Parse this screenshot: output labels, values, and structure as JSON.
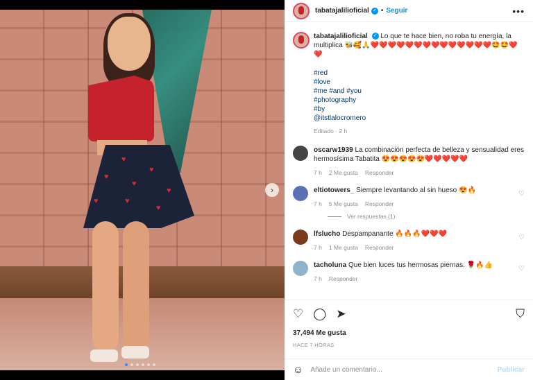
{
  "post": {
    "username": "tabatajalilioficial",
    "separator": "•",
    "follow_label": "Seguir",
    "more_label": "•••",
    "caption": {
      "username": "tabatajalilioficial",
      "text": "Lo que te hace bien, no roba tu energía, la multiplica 🐝🥰🙏❤️❤️❤️❤️❤️❤️❤️❤️❤️❤️❤️❤️❤️❤️🤩🤩❤️❤️",
      "hashtags": [
        "#red",
        "#love",
        "#me #and #you",
        "#photography",
        "#by",
        "@itstlalocromero"
      ],
      "edited": "Editado · 2 h"
    },
    "comments": [
      {
        "username": "oscarw1939",
        "text": "La combinación perfecta de belleza y sensualidad eres hermosísima Tabatita 😍😍😍😍😍❤️❤️❤️❤️❤️",
        "time": "7 h",
        "likes": "2 Me gusta",
        "reply": "Responder",
        "avatar_color": "#444444"
      },
      {
        "username": "eltiotowers_",
        "text": "Siempre levantando al sin hueso 😍🔥",
        "time": "7 h",
        "likes": "5 Me gusta",
        "reply": "Responder",
        "avatar_color": "#5b6fb5",
        "view_replies": "Ver respuestas (1)"
      },
      {
        "username": "lfslucho",
        "text": "Despampanante 🔥🔥🔥❤️❤️❤️",
        "time": "7 h",
        "likes": "1 Me gusta",
        "reply": "Responder",
        "avatar_color": "#7a3b1c"
      },
      {
        "username": "tacholuna",
        "text": "Que bien luces tus hermosas piernas. 🌹🔥👍",
        "time": "7 h",
        "likes": "",
        "reply": "Responder",
        "avatar_color": "#8fb3c9"
      }
    ],
    "likes_count": "37,494 Me gusta",
    "time_ago": "HACE 7 HORAS",
    "comment_placeholder": "Añade un comentario...",
    "publish_label": "Publicar"
  },
  "icons": {
    "heart": "heart-icon",
    "comment": "comment-icon",
    "share": "share-icon",
    "save": "bookmark-icon",
    "emoji": "emoji-icon",
    "next": "chevron-right-icon"
  },
  "colors": {
    "accent": "#0095f6",
    "muted": "#8e8e8e",
    "link": "#00376b"
  }
}
